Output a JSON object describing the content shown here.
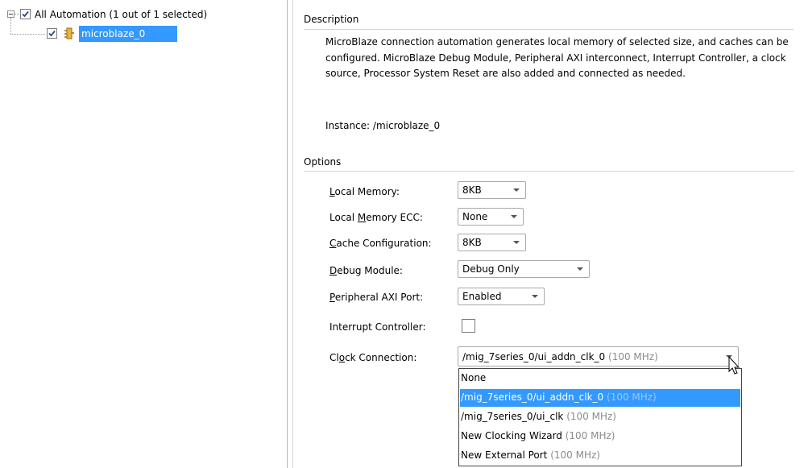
{
  "tree": {
    "root_label": "All Automation (1 out of 1 selected)",
    "child_label": "microblaze_0",
    "root_checked": true,
    "child_checked": true
  },
  "description": {
    "header": "Description",
    "text": "MicroBlaze connection automation generates local memory of selected size, and caches can be configured. MicroBlaze Debug Module, Peripheral AXI interconnect, Interrupt Controller, a clock source, Processor System Reset are also added and connected as needed.",
    "instance": "Instance: /microblaze_0"
  },
  "options": {
    "header": "Options",
    "local_memory": {
      "label": "Local Memory:",
      "value": "8KB"
    },
    "local_memory_ecc": {
      "label": "Local Memory ECC:",
      "value": "None"
    },
    "cache_configuration": {
      "label": "Cache Configuration:",
      "value": "8KB"
    },
    "debug_module": {
      "label": "Debug Module:",
      "value": "Debug Only"
    },
    "peripheral_axi_port": {
      "label": "Peripheral AXI Port:",
      "value": "Enabled"
    },
    "interrupt_controller": {
      "label": "Interrupt Controller:",
      "checked": false
    },
    "clock_connection": {
      "label": "Clock Connection:",
      "value": "/mig_7series_0/ui_addn_clk_0",
      "value_freq": "(100 MHz)",
      "options": [
        {
          "text": "None",
          "freq": ""
        },
        {
          "text": "/mig_7series_0/ui_addn_clk_0",
          "freq": "(100 MHz)"
        },
        {
          "text": "/mig_7series_0/ui_clk",
          "freq": "(100 MHz)"
        },
        {
          "text": "New Clocking Wizard",
          "freq": "(100 MHz)"
        },
        {
          "text": "New External Port",
          "freq": "(100 MHz)"
        }
      ],
      "highlighted_index": 1
    }
  },
  "colors": {
    "selection": "#3399ff",
    "separator": "#d5d5d5",
    "muted_text": "#8c8c8c"
  }
}
